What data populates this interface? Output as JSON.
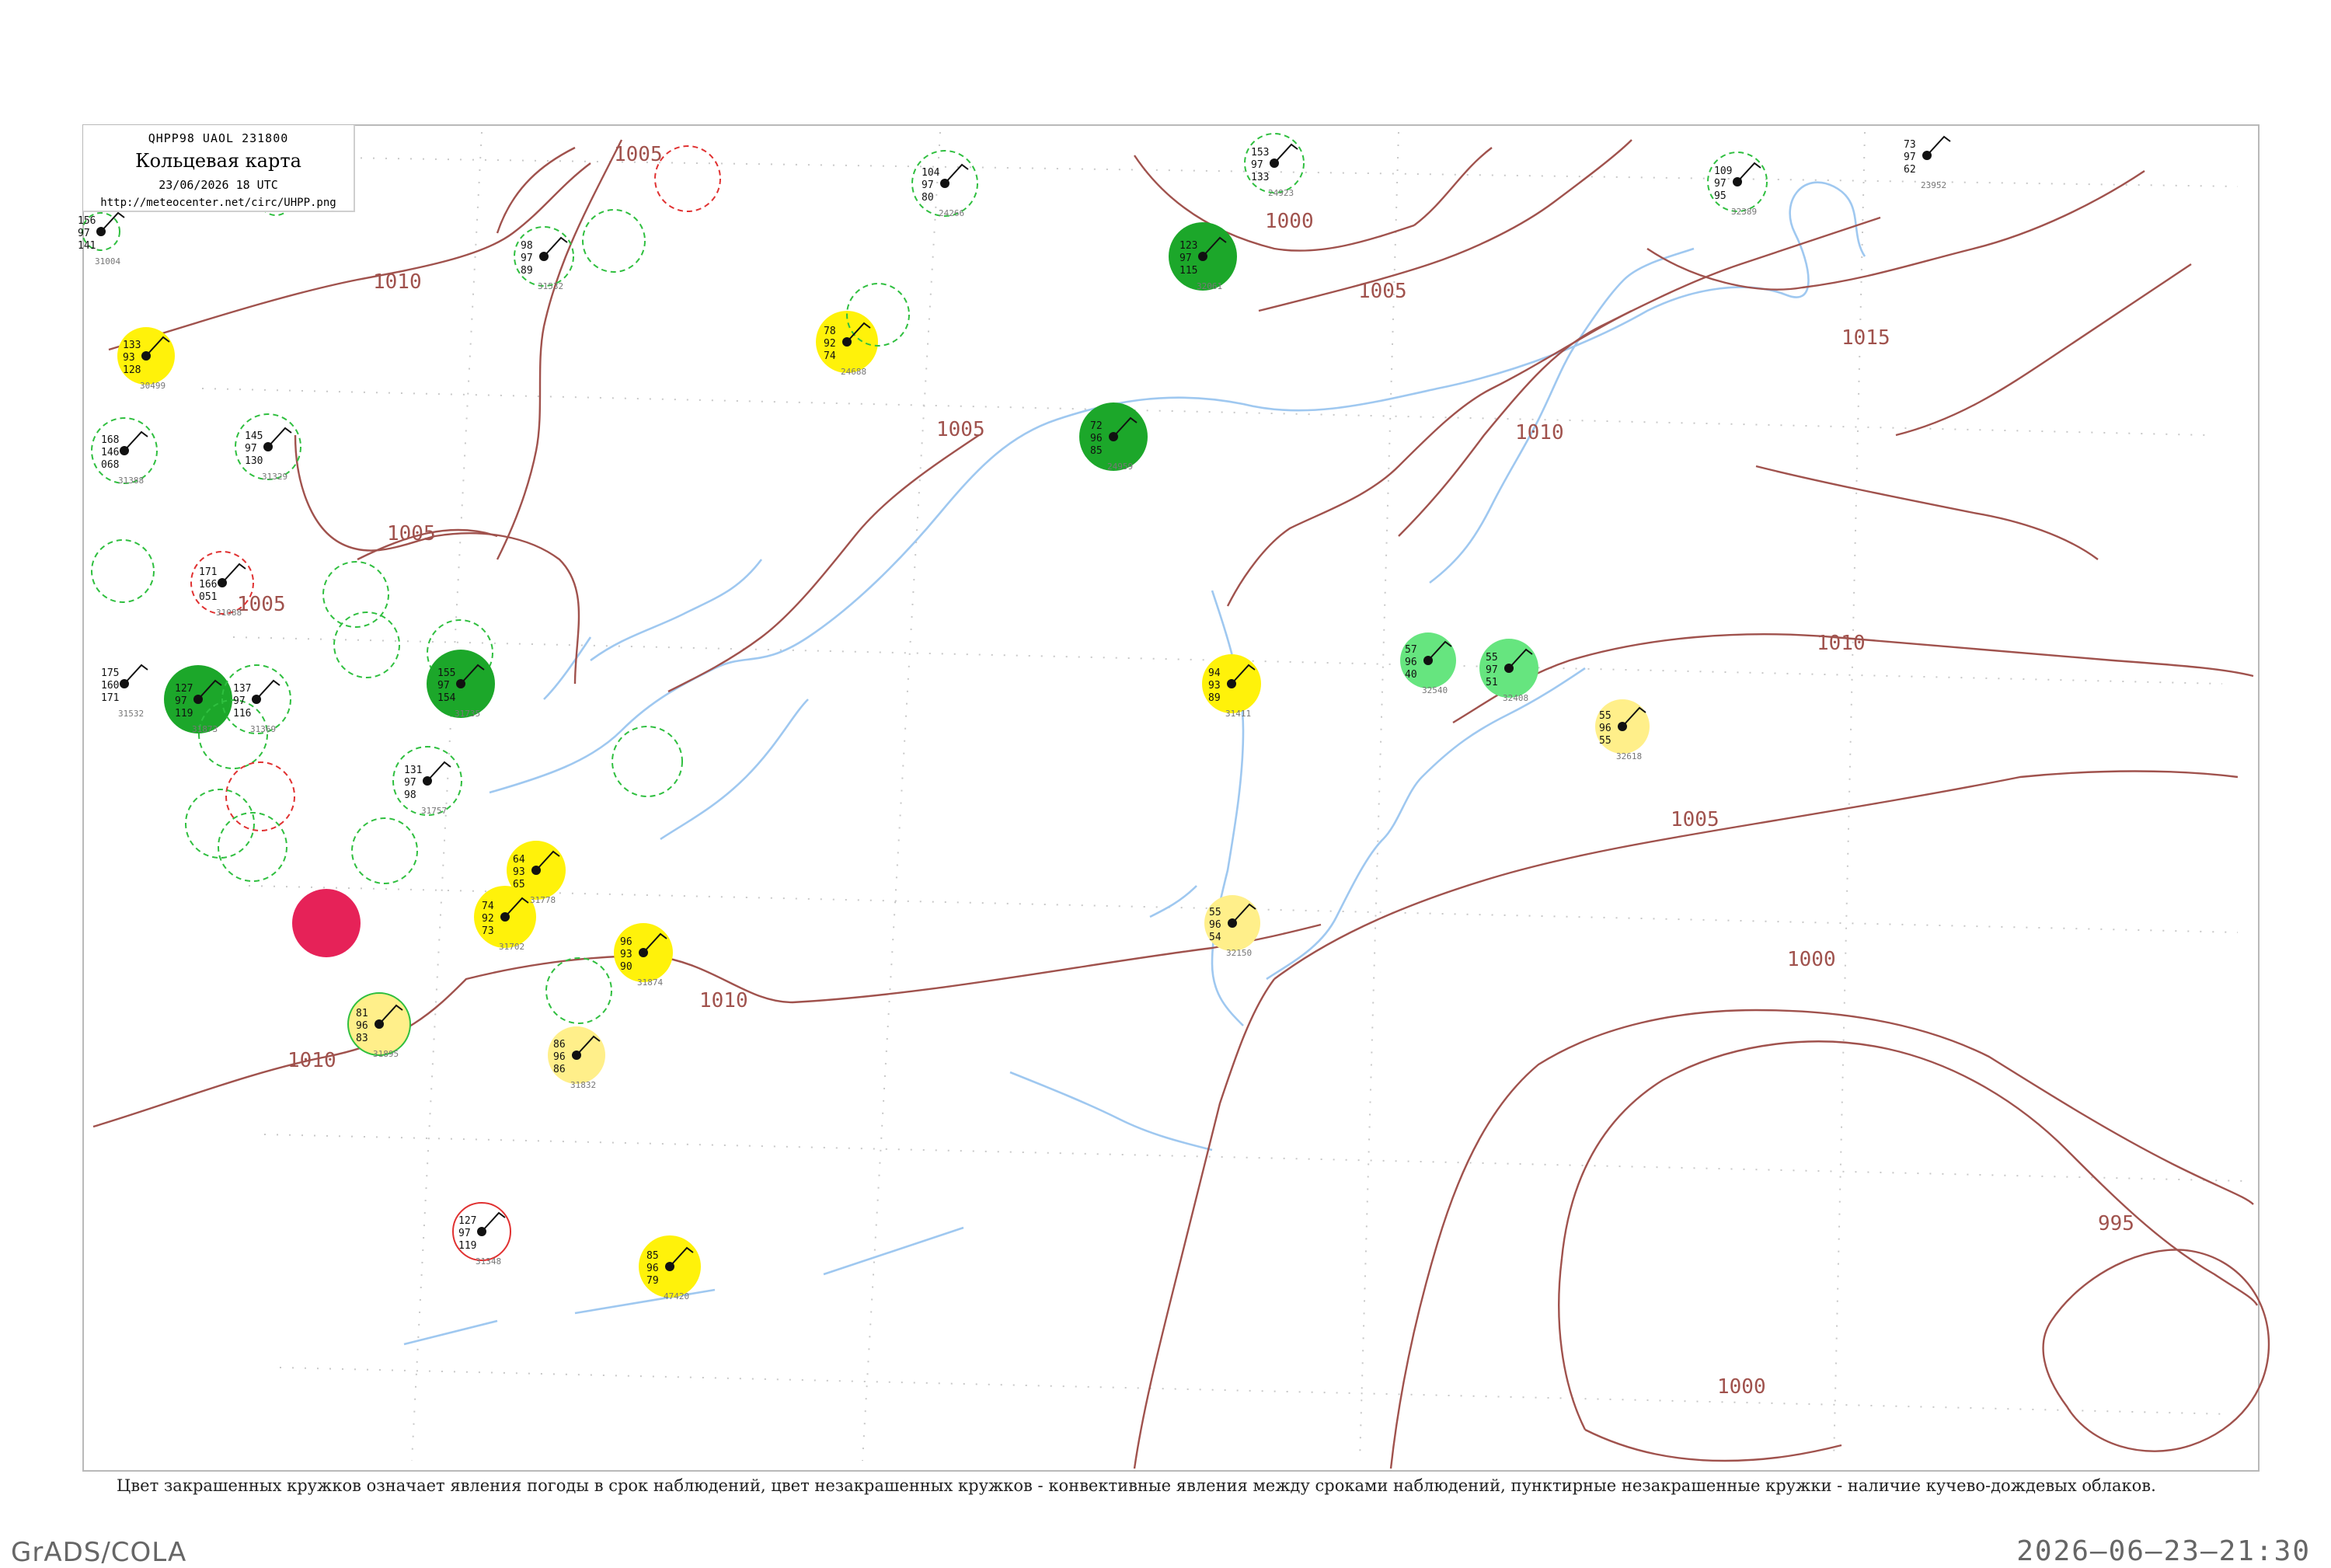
{
  "header": {
    "code": "QHPP98  UAOL  231800",
    "title": "Кольцевая карта",
    "datetime": "23/06/2026 18 UTC",
    "url": "http://meteocenter.net/circ/UHPP.png"
  },
  "caption": "Цвет закрашенных кружков означает явления погоды в срок наблюдений, цвет незакрашенных кружков - конвективные явления между сроками наблюдений, пунктирные незакрашенные кружки - наличие кучево-дождевых облаков.",
  "footer": {
    "left": "GrADS/COLA",
    "right": "2026–06–23–21:30"
  },
  "colors": {
    "isobar": "#a0524d",
    "coast": "#9fc8f0",
    "green_dark": "#1ca72a",
    "green_light": "#66e57f",
    "yellow": "#fff20a",
    "yellow_light": "#ffef8a",
    "red": "#e62258",
    "dashed_green": "#2fbf3f",
    "dashed_red": "#e03131"
  },
  "isobars": [
    {
      "label": "1000"
    },
    {
      "label": "1000"
    },
    {
      "label": "1000"
    },
    {
      "label": "1005"
    },
    {
      "label": "1005"
    },
    {
      "label": "1005"
    },
    {
      "label": "1005"
    },
    {
      "label": "1005"
    },
    {
      "label": "1005"
    },
    {
      "label": "1010"
    },
    {
      "label": "1010"
    },
    {
      "label": "1010"
    },
    {
      "label": "1010"
    },
    {
      "label": "1010"
    },
    {
      "label": "1015"
    },
    {
      "label": "995"
    }
  ],
  "stations": [
    {
      "id": "31004",
      "vals": [
        "156",
        "97",
        "141"
      ]
    },
    {
      "id": "30499",
      "vals": [
        "133",
        "93",
        "128"
      ]
    },
    {
      "id": "32061",
      "vals": [
        "123",
        "97",
        "115"
      ]
    },
    {
      "id": "24688",
      "vals": [
        "78",
        "92",
        "74"
      ]
    },
    {
      "id": "24959",
      "vals": [
        "72",
        "96",
        "85"
      ]
    },
    {
      "id": "31088",
      "vals": [
        "171",
        "166",
        "051"
      ]
    },
    {
      "id": "31388",
      "vals": [
        "168",
        "146",
        "068"
      ]
    },
    {
      "id": "31532",
      "vals": [
        "98",
        "97",
        "89"
      ]
    },
    {
      "id": "31873",
      "vals": [
        "127",
        "97",
        "119"
      ]
    },
    {
      "id": "31411",
      "vals": [
        "94",
        "93",
        "89"
      ]
    },
    {
      "id": "32618",
      "vals": [
        "55",
        "96",
        "55"
      ]
    },
    {
      "id": "32540",
      "vals": [
        "57",
        "96",
        "40"
      ]
    },
    {
      "id": "32408",
      "vals": [
        "55",
        "97",
        "51"
      ]
    },
    {
      "id": "31735",
      "vals": [
        "155",
        "97",
        "154"
      ]
    },
    {
      "id": "31757",
      "vals": [
        "131",
        "97",
        "98"
      ]
    },
    {
      "id": "31895",
      "vals": [
        "81",
        "96",
        "83"
      ]
    },
    {
      "id": "31832",
      "vals": [
        "86",
        "96",
        "86"
      ]
    },
    {
      "id": "31778",
      "vals": [
        "64",
        "93",
        "65"
      ]
    },
    {
      "id": "31702",
      "vals": [
        "74",
        "92",
        "73"
      ]
    },
    {
      "id": "31874",
      "vals": [
        "96",
        "93",
        "90"
      ]
    },
    {
      "id": "32150",
      "vals": [
        "55",
        "96",
        "54"
      ]
    },
    {
      "id": "47420",
      "vals": [
        "85",
        "96",
        "79"
      ]
    },
    {
      "id": "31369",
      "vals": [
        "137",
        "97",
        "116"
      ]
    },
    {
      "id": "31329",
      "vals": [
        "145",
        "97",
        "130"
      ]
    },
    {
      "id": "24266",
      "vals": [
        "104",
        "97",
        "80"
      ]
    },
    {
      "id": "32389",
      "vals": [
        "109",
        "97",
        "95"
      ]
    },
    {
      "id": "24923",
      "vals": [
        "153",
        "97",
        "133"
      ]
    },
    {
      "id": "23952",
      "vals": [
        "73",
        "97",
        "62"
      ]
    },
    {
      "id": "31348",
      "vals": [
        "127",
        "97",
        "119"
      ]
    },
    {
      "id": "31532b",
      "vals": [
        "175",
        "160",
        "171"
      ]
    }
  ],
  "map": {
    "grid": "dotted",
    "frame": "gray"
  }
}
